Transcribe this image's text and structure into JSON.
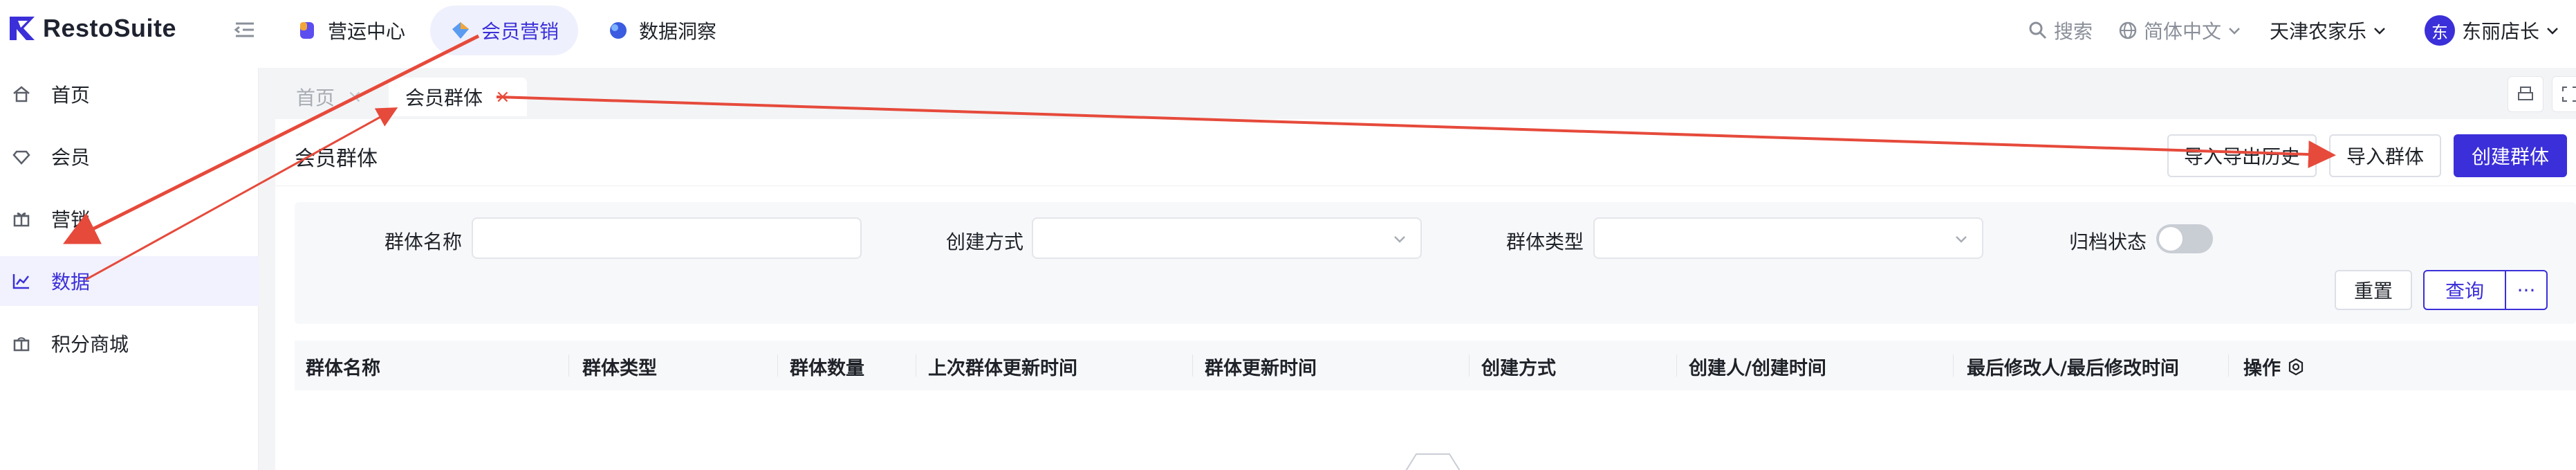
{
  "app": {
    "brand": "RestoSuite"
  },
  "topnav": {
    "tabs": [
      {
        "label": "营运中心"
      },
      {
        "label": "会员营销",
        "active": true
      },
      {
        "label": "数据洞察"
      }
    ]
  },
  "header_right": {
    "search_label": "搜索",
    "language": "简体中文",
    "store": "天津农家乐",
    "user_initial": "东",
    "user_name": "东丽店长"
  },
  "sidebar": {
    "items": [
      {
        "label": "首页",
        "icon": "home-icon"
      },
      {
        "label": "会员",
        "icon": "member-icon"
      },
      {
        "label": "营销",
        "icon": "gift-icon"
      },
      {
        "label": "数据",
        "icon": "chart-icon",
        "active": true
      },
      {
        "label": "积分商城",
        "icon": "store-icon"
      }
    ]
  },
  "page_tabs": [
    {
      "label": "首页",
      "close": "×"
    },
    {
      "label": "会员群体",
      "close": "×",
      "active": true
    }
  ],
  "page": {
    "title": "会员群体",
    "actions": {
      "history": "导入导出历史",
      "import": "导入群体",
      "create": "创建群体"
    }
  },
  "filters": {
    "name_label": "群体名称",
    "name_value": "",
    "method_label": "创建方式",
    "method_value": "",
    "type_label": "群体类型",
    "type_value": "",
    "archive_label": "归档状态",
    "archive_on": false,
    "reset": "重置",
    "query": "查询",
    "more": "···"
  },
  "table": {
    "columns": [
      "群体名称",
      "群体类型",
      "群体数量",
      "上次群体更新时间",
      "群体更新时间",
      "创建方式",
      "创建人/创建时间",
      "最后修改人/最后修改时间",
      "操作"
    ],
    "rows": []
  },
  "colors": {
    "primary": "#3b2fd9",
    "annotation_arrow": "#e64a3b",
    "page_bg": "#f3f4f6"
  }
}
